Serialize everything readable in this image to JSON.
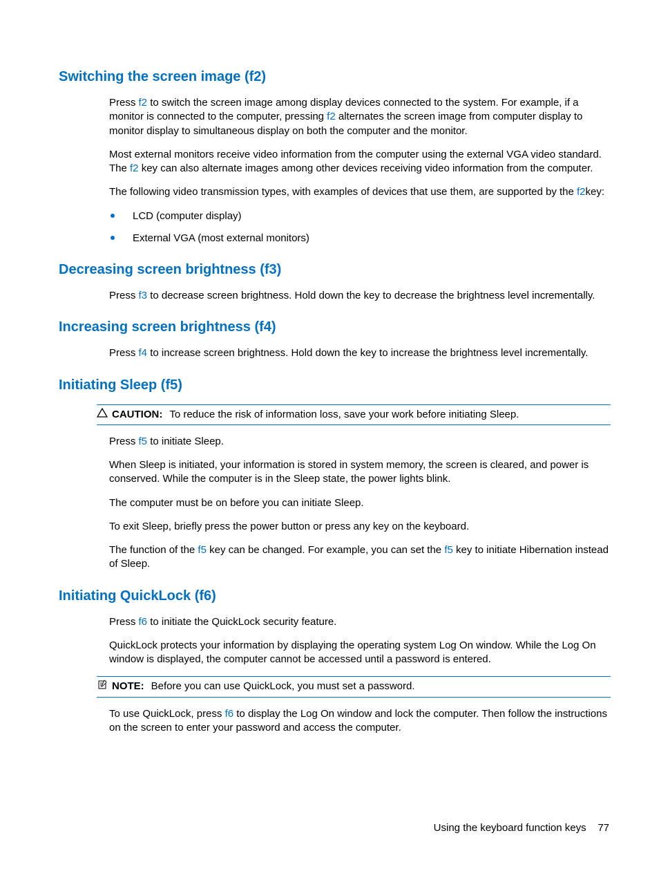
{
  "sections": {
    "f2": {
      "heading": "Switching the screen image (f2)",
      "p1a": "Press ",
      "p1b": " to switch the screen image among display devices connected to the system. For example, if a monitor is connected to the computer, pressing ",
      "p1c": " alternates the screen image from computer display to monitor display to simultaneous display on both the computer and the monitor.",
      "p2a": "Most external monitors receive video information from the computer using the external VGA video standard. The ",
      "p2b": " key can also alternate images among other devices receiving video information from the computer.",
      "p3a": "The following video transmission types, with examples of devices that use them, are supported by the ",
      "p3b": "key:",
      "li1": "LCD (computer display)",
      "li2": "External VGA (most external monitors)",
      "key": "f2"
    },
    "f3": {
      "heading": "Decreasing screen brightness (f3)",
      "p1a": "Press ",
      "p1b": " to decrease screen brightness. Hold down the key to decrease the brightness level incrementally.",
      "key": "f3"
    },
    "f4": {
      "heading": "Increasing screen brightness (f4)",
      "p1a": "Press ",
      "p1b": " to increase screen brightness. Hold down the key to increase the brightness level incrementally.",
      "key": "f4"
    },
    "f5": {
      "heading": "Initiating Sleep (f5)",
      "caution_label": "CAUTION:",
      "caution_text": "To reduce the risk of information loss, save your work before initiating Sleep.",
      "p1a": "Press ",
      "p1b": " to initiate Sleep.",
      "p2": "When Sleep is initiated, your information is stored in system memory, the screen is cleared, and power is conserved. While the computer is in the Sleep state, the power lights blink.",
      "p3": "The computer must be on before you can initiate Sleep.",
      "p4": "To exit Sleep, briefly press the power button or press any key on the keyboard.",
      "p5a": "The function of the ",
      "p5b": " key can be changed. For example, you can set the ",
      "p5c": " key to initiate Hibernation instead of Sleep.",
      "key": "f5"
    },
    "f6": {
      "heading": "Initiating QuickLock (f6)",
      "p1a": "Press ",
      "p1b": " to initiate the QuickLock security feature.",
      "p2": "QuickLock protects your information by displaying the operating system Log On window. While the Log On window is displayed, the computer cannot be accessed until a password is entered.",
      "note_label": "NOTE:",
      "note_text": "Before you can use QuickLock, you must set a password.",
      "p3a": "To use QuickLock, press ",
      "p3b": " to display the Log On window and lock the computer. Then follow the instructions on the screen to enter your password and access the computer.",
      "key": "f6"
    }
  },
  "footer": {
    "text": "Using the keyboard function keys",
    "page": "77"
  }
}
